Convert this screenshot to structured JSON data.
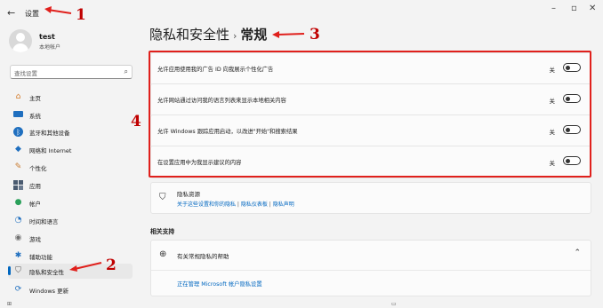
{
  "window": {
    "back_icon": "back-arrow-icon",
    "title": "设置",
    "controls": [
      "–",
      "▫",
      "✕"
    ]
  },
  "user": {
    "name": "test",
    "account_type": "本地帐户"
  },
  "search": {
    "placeholder": "查找设置",
    "icon": "search-icon"
  },
  "sidebar": {
    "items": [
      {
        "label": "主页",
        "icon": "home-icon"
      },
      {
        "label": "系统",
        "icon": "system-icon"
      },
      {
        "label": "蓝牙和其他设备",
        "icon": "bluetooth-icon"
      },
      {
        "label": "网络和 Internet",
        "icon": "network-icon"
      },
      {
        "label": "个性化",
        "icon": "personalization-icon"
      },
      {
        "label": "应用",
        "icon": "apps-icon"
      },
      {
        "label": "帐户",
        "icon": "accounts-icon"
      },
      {
        "label": "时间和语言",
        "icon": "time-language-icon"
      },
      {
        "label": "游戏",
        "icon": "gaming-icon"
      },
      {
        "label": "辅助功能",
        "icon": "accessibility-icon"
      },
      {
        "label": "隐私和安全性",
        "icon": "privacy-shield-icon",
        "selected": true
      },
      {
        "label": "Windows 更新",
        "icon": "windows-update-icon"
      }
    ]
  },
  "breadcrumb": {
    "parent": "隐私和安全性",
    "separator": "›",
    "current": "常规"
  },
  "settings": [
    {
      "label": "允许应用使用我的广告 ID 向我展示个性化广告",
      "state": "关",
      "on": false
    },
    {
      "label": "允许网站通过访问我的语言列表来显示本地相关内容",
      "state": "关",
      "on": false
    },
    {
      "label": "允许 Windows 跟踪应用启动，以改进\"开始\"和搜索结果",
      "state": "关",
      "on": false
    },
    {
      "label": "在设置应用中为我显示建议的内容",
      "state": "关",
      "on": false
    }
  ],
  "privacy_resources": {
    "title": "隐私资源",
    "link1": "关于这些设置和你的隐私",
    "sep1": " | ",
    "link2": "隐私仪表板",
    "sep2": " | ",
    "link3": "隐私声明"
  },
  "related": {
    "heading": "相关支持",
    "help_title": "有关常规隐私的帮助",
    "help_link": "正在管理 Microsoft 帐户隐私设置"
  },
  "annotations": [
    "1",
    "2",
    "3",
    "4"
  ],
  "colors": {
    "accent": "#0067c0",
    "annotation": "#e0201c"
  }
}
